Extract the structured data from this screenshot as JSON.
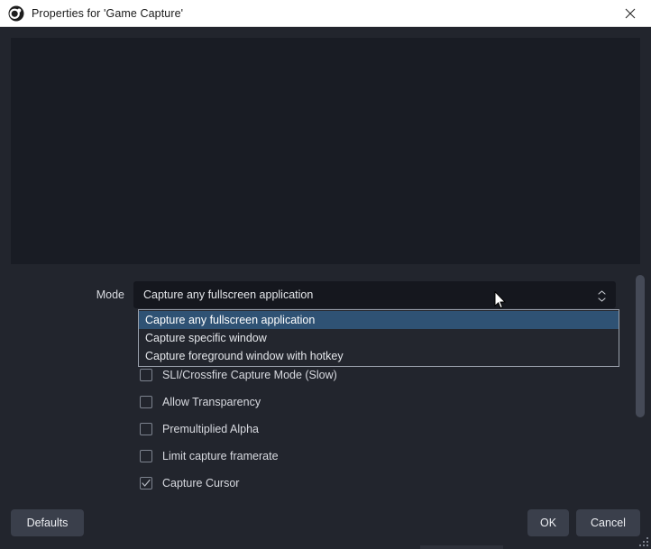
{
  "window": {
    "title": "Properties for 'Game Capture'",
    "icon": "obs-logo-icon",
    "close_icon": "close-icon"
  },
  "preview": {
    "name": "source-preview",
    "background_color": "#191c24"
  },
  "form": {
    "mode_label": "Mode",
    "mode_combobox": {
      "value": "Capture any fullscreen application",
      "expanded": true,
      "arrow_icon": "chevron-updown-icon"
    },
    "dropdown_options": [
      {
        "label": "Capture any fullscreen application",
        "selected": true
      },
      {
        "label": "Capture specific window",
        "selected": false
      },
      {
        "label": "Capture foreground window with hotkey",
        "selected": false
      }
    ],
    "checkboxes": [
      {
        "label": "SLI/Crossfire Capture Mode (Slow)",
        "checked": false,
        "name": "checkbox-sli-crossfire"
      },
      {
        "label": "Allow Transparency",
        "checked": false,
        "name": "checkbox-allow-transparency"
      },
      {
        "label": "Premultiplied Alpha",
        "checked": false,
        "name": "checkbox-premultiplied-alpha"
      },
      {
        "label": "Limit capture framerate",
        "checked": false,
        "name": "checkbox-limit-framerate"
      },
      {
        "label": "Capture Cursor",
        "checked": true,
        "name": "checkbox-capture-cursor"
      }
    ]
  },
  "buttons": {
    "defaults": "Defaults",
    "ok": "OK",
    "cancel": "Cancel"
  },
  "colors": {
    "dialog_bg": "#22252d",
    "preview_bg": "#191c24",
    "field_bg": "#15171e",
    "button_bg": "#3a3f4b",
    "highlight": "#2f5274",
    "text": "#d8dae0",
    "titlebar_bg": "#ffffff",
    "titlebar_text": "#1a1a1a",
    "scrollbar_thumb": "#454a57"
  }
}
